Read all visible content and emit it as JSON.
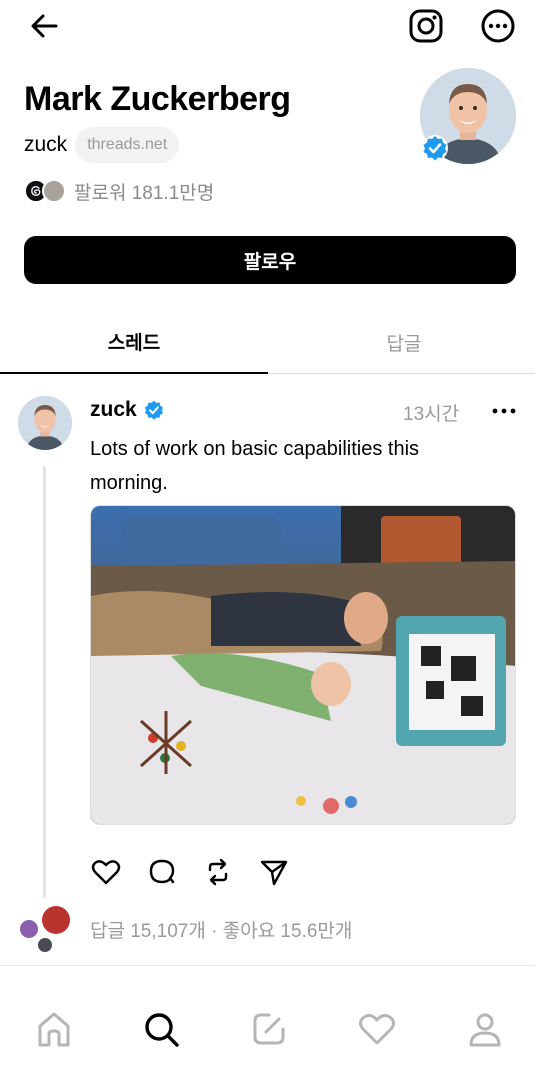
{
  "header": {
    "back_icon": "back-arrow-icon",
    "instagram_icon": "instagram-icon",
    "more_icon": "more-options-icon"
  },
  "profile": {
    "name": "Mark Zuckerberg",
    "handle": "zuck",
    "domain": "threads.net",
    "followers": "팔로워 181.1만명",
    "follow_label": "팔로우"
  },
  "tabs": [
    {
      "label": "스레드",
      "active": true
    },
    {
      "label": "답글",
      "active": false
    }
  ],
  "post": {
    "author": "zuck",
    "time": "13시간",
    "text": "Lots of work on basic capabilities this morning.",
    "stats": "답글 15,107개 · 좋아요 15.6만개"
  },
  "bottom_nav": [
    {
      "icon": "home-icon"
    },
    {
      "icon": "search-icon",
      "active": true
    },
    {
      "icon": "compose-icon"
    },
    {
      "icon": "heart-icon"
    },
    {
      "icon": "profile-icon"
    }
  ],
  "colors": {
    "verified": "#1d9bf0",
    "muted": "#9a9a9a",
    "button": "#000000"
  }
}
